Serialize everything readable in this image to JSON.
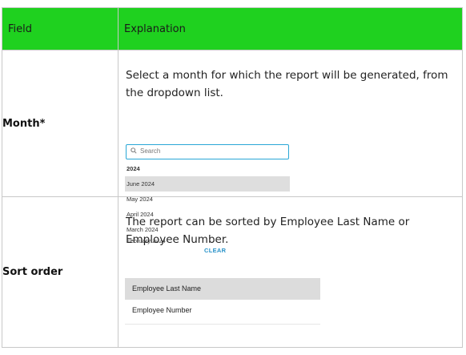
{
  "table": {
    "header": {
      "field": "Field",
      "explanation": "Explanation"
    },
    "rows": [
      {
        "field": "Month*",
        "explanation": "Select a month for which the report will be generated, from the dropdown list.",
        "dropdown": {
          "search_placeholder": "Search",
          "year_group": "2024",
          "options": [
            "June 2024",
            "May 2024",
            "April 2024",
            "March 2024",
            "February 2024"
          ],
          "selected": "June 2024",
          "clear_label": "CLEAR"
        }
      },
      {
        "field": "Sort order",
        "explanation": "The report can be sorted by Employee Last Name or Employee Number.",
        "sort_options": [
          "Employee Last Name",
          "Employee Number"
        ],
        "selected": "Employee Last Name"
      }
    ]
  },
  "colors": {
    "header_bg": "#1fd11f",
    "accent": "#2aa7d6",
    "selected_bg": "#dedede"
  },
  "icons": {
    "search": "search-icon"
  }
}
